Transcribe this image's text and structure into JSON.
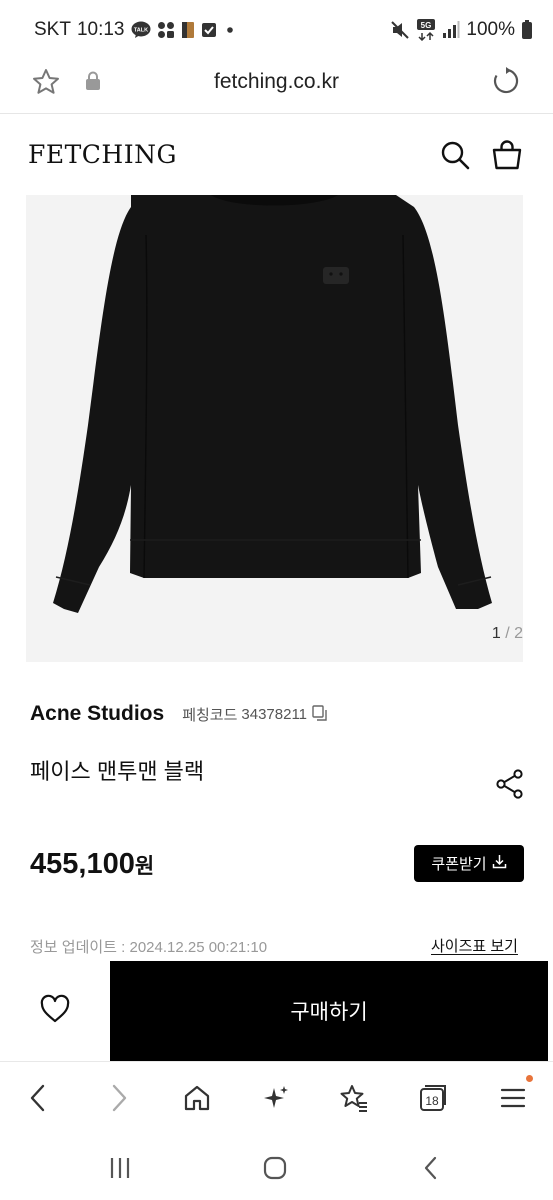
{
  "status_bar": {
    "carrier": "SKT",
    "time": "10:13",
    "talk_badge": "TALK",
    "network_badge": "5G",
    "battery": "100%"
  },
  "url_bar": {
    "url": "fetching.co.kr"
  },
  "header": {
    "logo": "FETCHING"
  },
  "product": {
    "image_index": "1",
    "image_separator": " / ",
    "image_total": "2",
    "brand": "Acne Studios",
    "code_label": "페칭코드",
    "code": "34378211",
    "title": "페이스 맨투맨 블랙",
    "price_value": "455,100",
    "price_unit": "원",
    "coupon_label": "쿠폰받기",
    "update_info": "정보 업데이트 : 2024.12.25 00:21:10",
    "size_chart_label": "사이즈표 보기",
    "buy_label": "구매하기"
  },
  "toolbar": {
    "tabs_count": "18"
  },
  "icons": {
    "favorite": "star-outline-icon",
    "lock": "lock-icon",
    "reload": "reload-icon",
    "search": "search-icon",
    "bag": "shopping-bag-icon",
    "copy": "copy-icon",
    "share": "share-icon",
    "download": "download-icon",
    "wishlist": "heart-icon"
  },
  "colors": {
    "accent": "#000000",
    "badge": "#e8743b",
    "muted_text": "#999999"
  }
}
